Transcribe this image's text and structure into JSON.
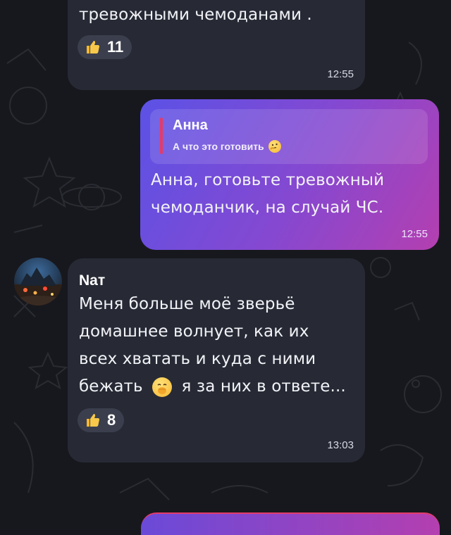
{
  "messages": [
    {
      "text_tail": "тревожными чемоданами .",
      "reaction": {
        "icon": "thumbs-up-icon",
        "count": "11"
      },
      "time": "12:55"
    },
    {
      "outgoing": true,
      "reply": {
        "author": "Анна",
        "text": "А что это готовить",
        "emoji": "thinking-face-emoji"
      },
      "lines": [
        "Анна, готовьте тревожный",
        "чемоданчик, на случай ЧС."
      ],
      "time": "12:55"
    },
    {
      "author": "Nат",
      "lines": [
        "Меня больше моё зверьё",
        "домашнее волнует, как их",
        "всех хватать и куда с ними"
      ],
      "last_line_start": "бежать",
      "last_line_end": "я за них в ответе...",
      "emoji": "hand-over-mouth-emoji",
      "reaction": {
        "icon": "thumbs-up-icon",
        "count": "8"
      },
      "time": "13:03"
    }
  ],
  "colors": {
    "background": "#17181d",
    "incoming_bubble": "#272a35",
    "outgoing_gradient_start": "#5b52e6",
    "outgoing_gradient_end": "#b43fb0",
    "reply_bar": "#e23b6a",
    "author_name": "#ffffff"
  }
}
